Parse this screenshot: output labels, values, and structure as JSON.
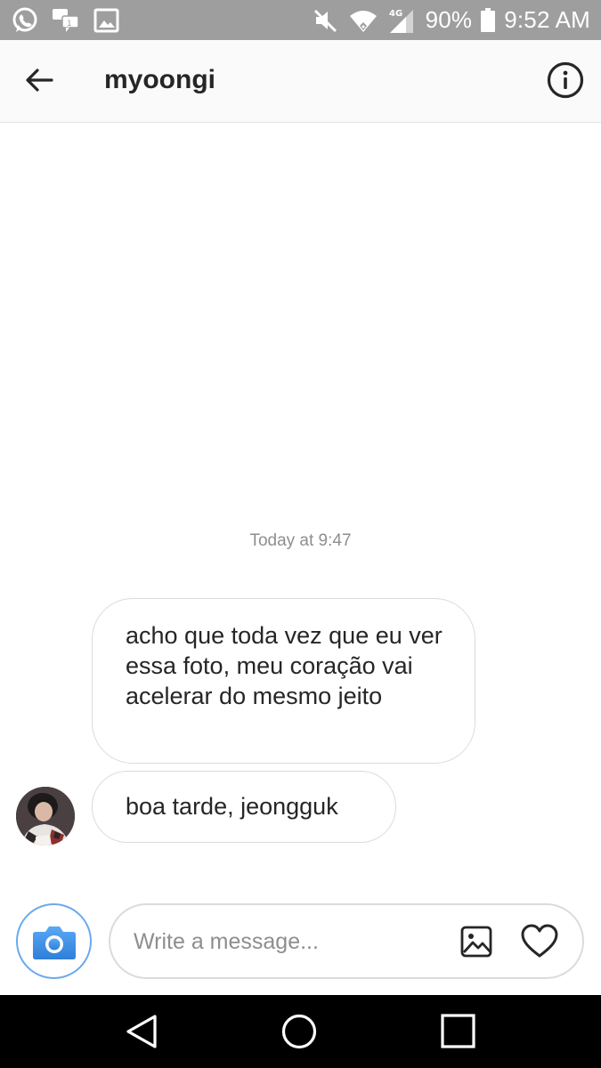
{
  "status_bar": {
    "battery": "90%",
    "time": "9:52 AM",
    "network": "4G",
    "icons_left": [
      "whatsapp-icon",
      "chat-notification-icon",
      "image-notification-icon"
    ],
    "icons_right": [
      "mute-icon",
      "wifi-icon",
      "signal-icon",
      "battery-icon"
    ]
  },
  "header": {
    "title": "myoongi",
    "back_icon": "arrow-left-icon",
    "info_icon": "info-circle-icon"
  },
  "conversation": {
    "timestamp": "Today at 9:47",
    "messages": [
      {
        "text": "acho que toda vez que eu ver essa foto, meu coração vai acelerar do mesmo jeito"
      },
      {
        "text": "boa tarde, jeongguk"
      }
    ]
  },
  "composer": {
    "placeholder": "Write a message...",
    "camera_icon": "camera-icon",
    "gallery_icon": "image-icon",
    "like_icon": "heart-icon"
  },
  "colors": {
    "accent_blue": "#3897f0",
    "status_bar": "#9e9e9e",
    "bubble_border": "#dbdbdb",
    "text": "#262626",
    "muted_text": "#8e8e8e"
  }
}
